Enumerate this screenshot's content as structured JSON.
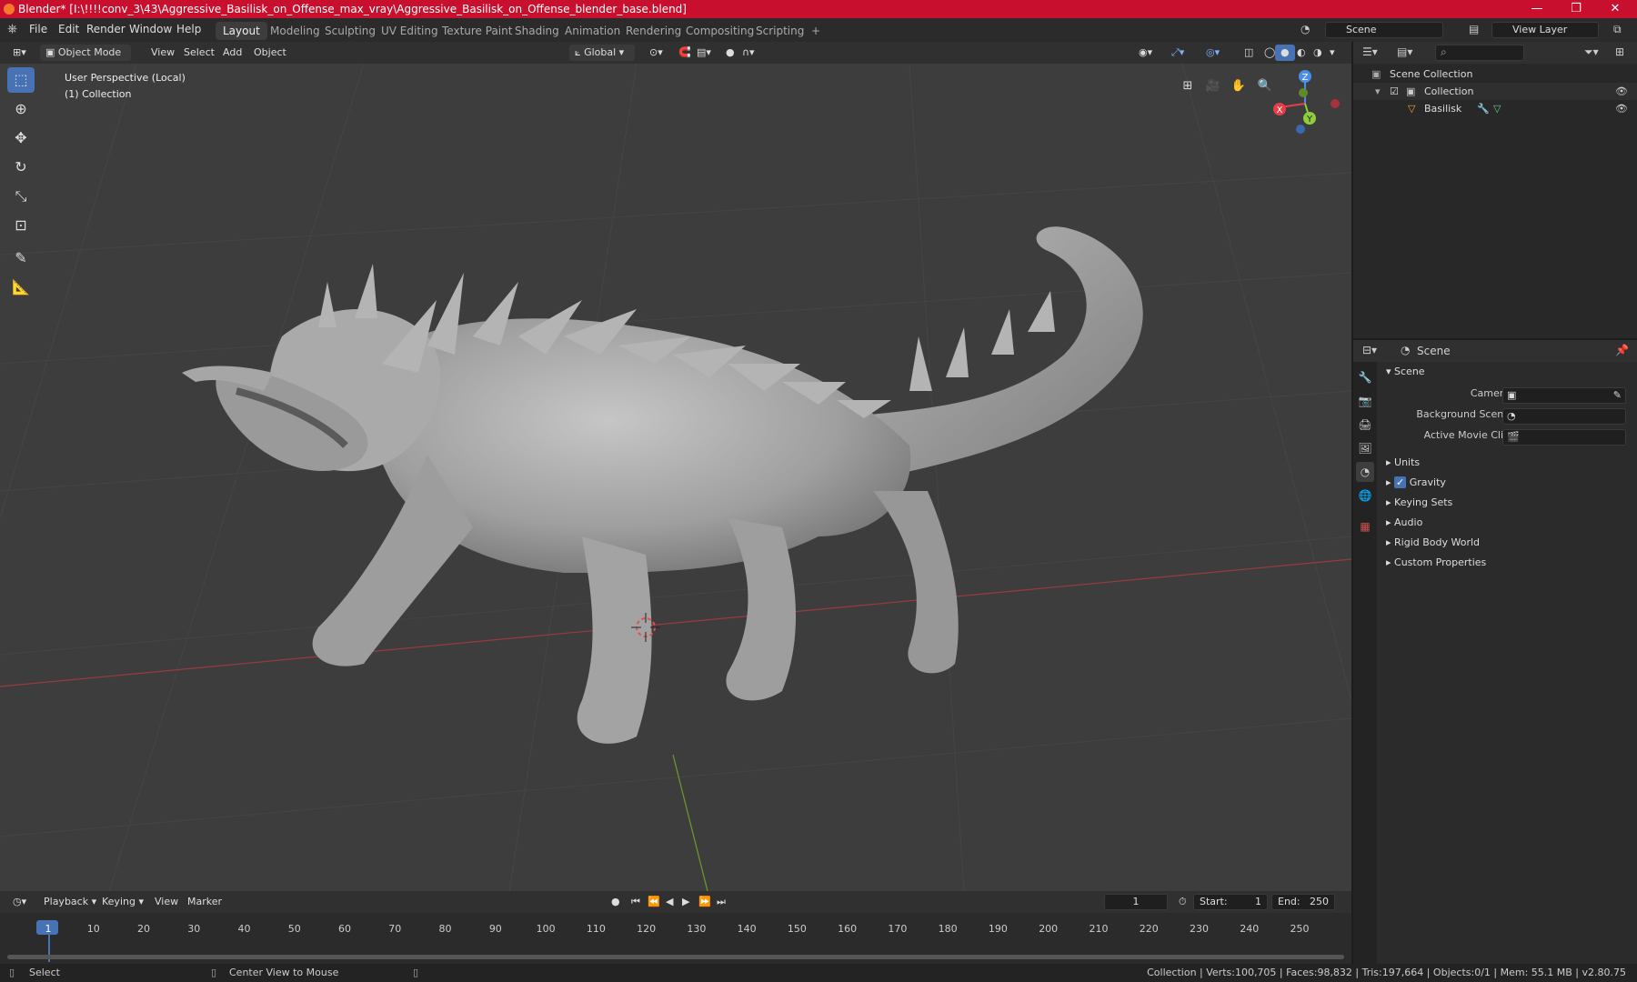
{
  "title_bar": {
    "title": "Blender* [I:\\!!!!conv_3\\43\\Aggressive_Basilisk_on_Offense_max_vray\\Aggressive_Basilisk_on_Offense_blender_base.blend]",
    "minimize": "—",
    "maximize": "❐",
    "close": "✕"
  },
  "menu": [
    "File",
    "Edit",
    "Render",
    "Window",
    "Help"
  ],
  "workspaces": [
    "Layout",
    "Modeling",
    "Sculpting",
    "UV Editing",
    "Texture Paint",
    "Shading",
    "Animation",
    "Rendering",
    "Compositing",
    "Scripting",
    "+"
  ],
  "active_workspace": "Layout",
  "scene_selector": "Scene",
  "view_layer": "View Layer",
  "viewport_header": {
    "mode": "Object Mode",
    "menus": [
      "View",
      "Select",
      "Add",
      "Object"
    ],
    "orientation": "Global"
  },
  "viewport": {
    "perspective": "User Perspective (Local)",
    "collection": "(1) Collection",
    "gizmo_axes": {
      "x": "X",
      "y": "Y",
      "z": "Z"
    }
  },
  "outliner": {
    "root": "Scene Collection",
    "collection": "Collection",
    "object": "Basilisk"
  },
  "properties": {
    "header": "Scene",
    "panel": "Scene",
    "fields": [
      {
        "label": "Camera"
      },
      {
        "label": "Background Scene"
      },
      {
        "label": "Active Movie Clip"
      }
    ],
    "sections": [
      "Units",
      "Gravity",
      "Keying Sets",
      "Audio",
      "Rigid Body World",
      "Custom Properties"
    ]
  },
  "timeline": {
    "menus": [
      "Playback",
      "Keying",
      "View",
      "Marker"
    ],
    "current_frame": "1",
    "start_label": "Start:",
    "start": "1",
    "end_label": "End:",
    "end": "250",
    "ticks": [
      "1",
      "10",
      "20",
      "30",
      "40",
      "50",
      "60",
      "70",
      "80",
      "90",
      "100",
      "110",
      "120",
      "130",
      "140",
      "150",
      "160",
      "170",
      "180",
      "190",
      "200",
      "210",
      "220",
      "230",
      "240",
      "250"
    ]
  },
  "status_bar": {
    "select": "Select",
    "center": "Center View to Mouse",
    "stats": "Collection | Verts:100,705 | Faces:98,832 | Tris:197,664 | Objects:0/1 | Mem: 55.1 MB | v2.80.75"
  },
  "colors": {
    "title_bar": "#c8102e",
    "active_blue": "#4772b3",
    "axis_x": "#e63d4a",
    "axis_y": "#8fce3a",
    "axis_z": "#4a8ee8"
  }
}
